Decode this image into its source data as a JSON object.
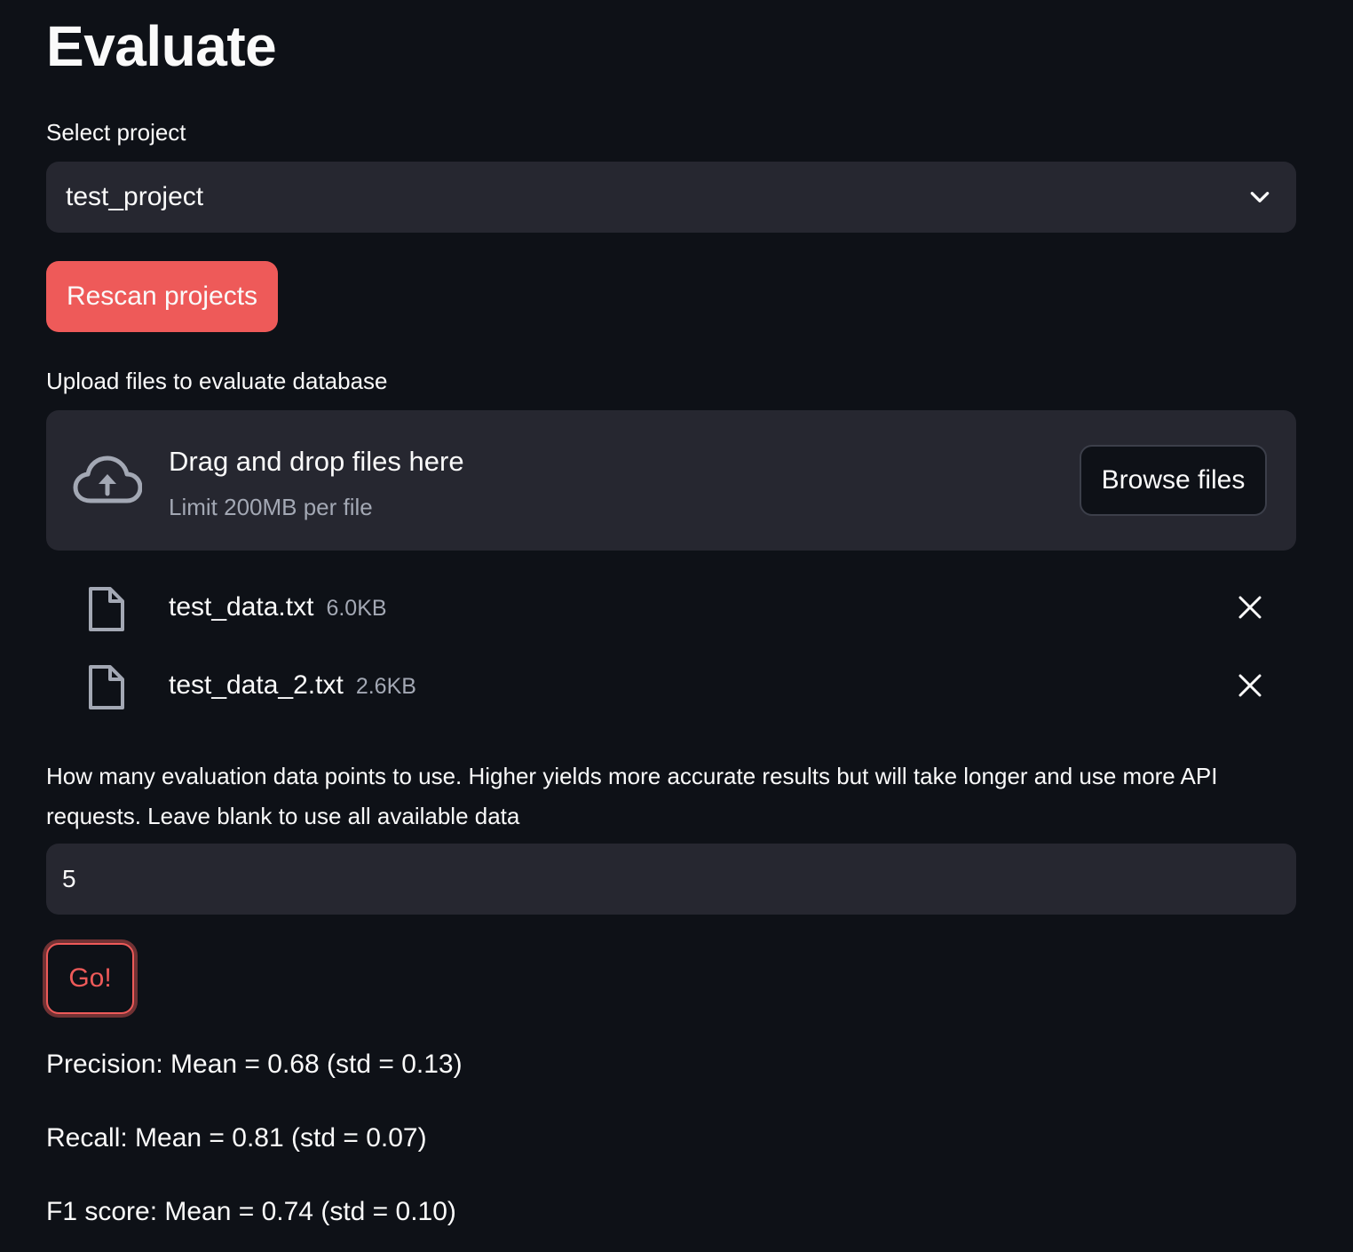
{
  "page": {
    "title": "Evaluate"
  },
  "project_select": {
    "label": "Select project",
    "value": "test_project",
    "icon": "chevron-down-icon"
  },
  "rescan_button": {
    "label": "Rescan projects",
    "color": "#ee5a59"
  },
  "uploader": {
    "label": "Upload files to evaluate database",
    "drop_title": "Drag and drop files here",
    "limit_text": "Limit 200MB per file",
    "browse_label": "Browse files",
    "icon": "cloud-upload-icon",
    "files": [
      {
        "name": "test_data.txt",
        "size": "6.0KB"
      },
      {
        "name": "test_data_2.txt",
        "size": "2.6KB"
      }
    ]
  },
  "datapoints": {
    "label": "How many evaluation data points to use. Higher yields more accurate results but will take longer and use more API requests. Leave blank to use all available data",
    "value": "5"
  },
  "go_button": {
    "label": "Go!",
    "color": "#ee5a59"
  },
  "results": {
    "precision": "Precision: Mean = 0.68 (std = 0.13)",
    "recall": "Recall: Mean = 0.81 (std = 0.07)",
    "f1": "F1 score: Mean = 0.74 (std = 0.10)"
  },
  "colors": {
    "background": "#0e1117",
    "surface": "#262730",
    "accent": "#ee5a59",
    "muted_text": "#a3a8b4"
  }
}
